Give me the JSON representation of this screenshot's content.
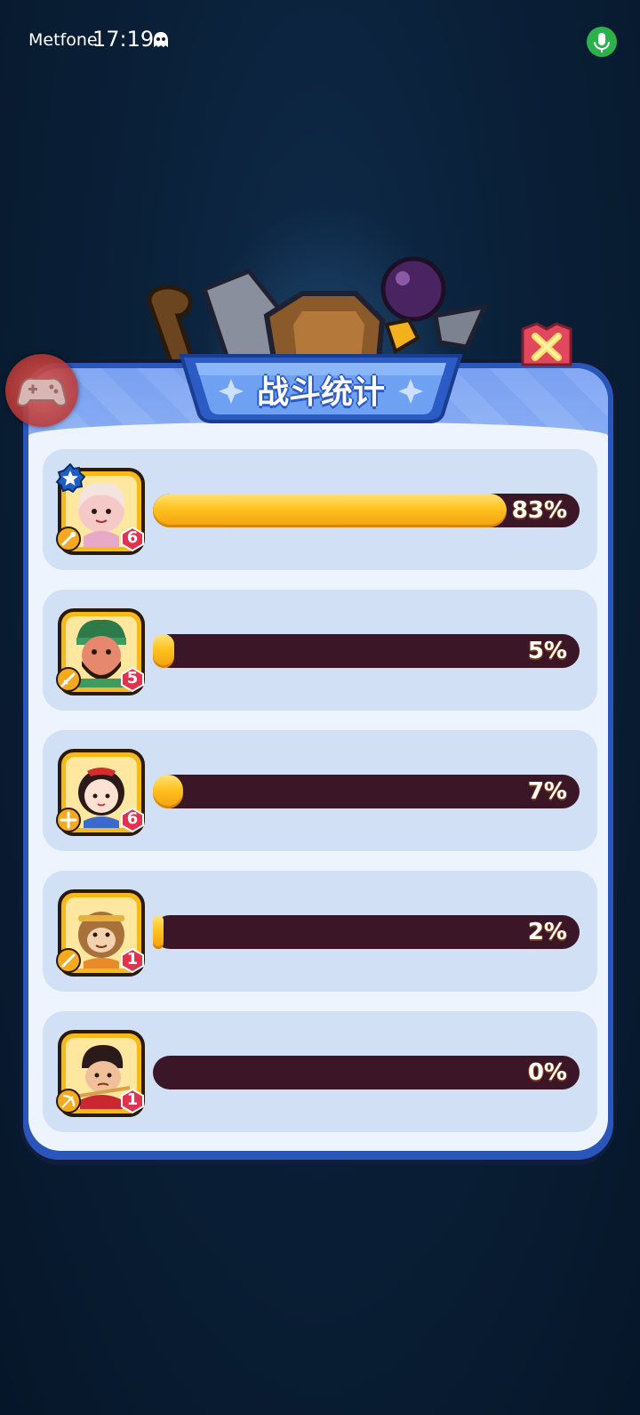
{
  "status_bar": {
    "carrier": "Metfone",
    "time": "17:19",
    "icons": [
      "ghost-icon",
      "microphone-icon"
    ],
    "mic_color": "#2bb24c"
  },
  "overlay": {
    "icon": "gamepad-icon"
  },
  "panel": {
    "title": "战斗统计",
    "close_icon": "close-icon",
    "accent": "#2a55b9",
    "bar_color": "#ffc21f",
    "track_color": "#3a1627"
  },
  "heroes": [
    {
      "percent_label": "83%",
      "percent": 83,
      "level": "6",
      "class_icon": "wand-icon",
      "star": true
    },
    {
      "percent_label": "5%",
      "percent": 5,
      "level": "5",
      "class_icon": "sword-icon",
      "star": false
    },
    {
      "percent_label": "7%",
      "percent": 7,
      "level": "6",
      "class_icon": "cross-icon",
      "star": false
    },
    {
      "percent_label": "2%",
      "percent": 2,
      "level": "1",
      "class_icon": "staff-icon",
      "star": false
    },
    {
      "percent_label": "0%",
      "percent": 0,
      "level": "1",
      "class_icon": "bow-icon",
      "star": false
    }
  ]
}
